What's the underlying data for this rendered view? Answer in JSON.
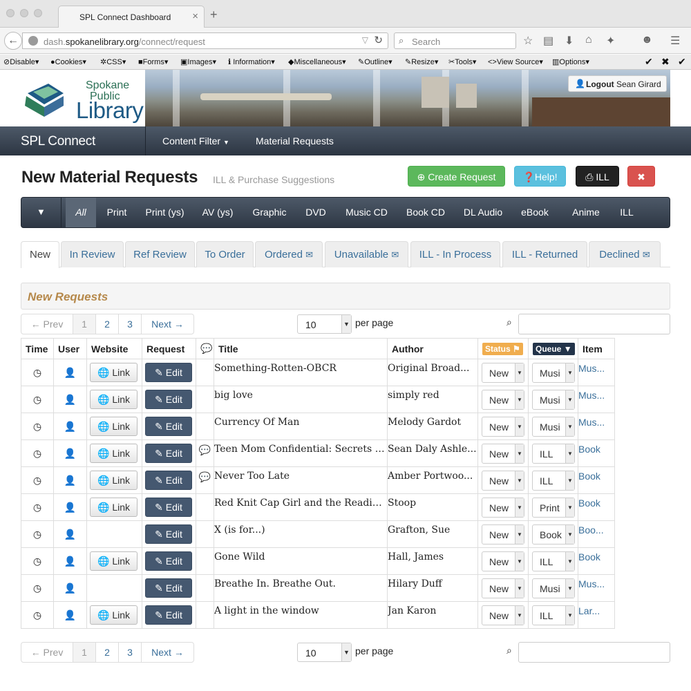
{
  "browser": {
    "tab_title": "SPL Connect Dashboard",
    "url_prefix": "dash.",
    "url_domain": "spokanelibrary.org",
    "url_path": "/connect/request",
    "search_placeholder": "Search"
  },
  "devtoolbar": {
    "items": [
      "Disable",
      "Cookies",
      "CSS",
      "Forms",
      "Images",
      "Information",
      "Miscellaneous",
      "Outline",
      "Resize",
      "Tools",
      "View Source",
      "Options"
    ]
  },
  "header": {
    "logo_line1": "Spokane",
    "logo_line2": "Public",
    "logo_line3": "Library",
    "logout_label": "Logout",
    "user_name": "Sean Girard"
  },
  "mainnav": {
    "brand": "SPL Connect",
    "content_filter": "Content Filter",
    "material_requests": "Material Requests"
  },
  "page": {
    "title": "New Material Requests",
    "subtitle": "ILL & Purchase Suggestions",
    "create_label": "Create Request",
    "help_label": "Help!",
    "ill_label": "ILL",
    "close_label": "✖"
  },
  "types": [
    "All",
    "Print",
    "Print (ys)",
    "AV (ys)",
    "Graphic",
    "DVD",
    "Music CD",
    "Book CD",
    "DL Audio",
    "eBook",
    "Anime",
    "ILL"
  ],
  "status_tabs": [
    "New",
    "In Review",
    "Ref Review",
    "To Order",
    "Ordered",
    "Unavailable",
    "ILL - In Process",
    "ILL - Returned",
    "Declined"
  ],
  "section_title": "New Requests",
  "pager": {
    "prev": "← Prev",
    "pages": [
      "1",
      "2",
      "3"
    ],
    "next": "Next →",
    "per_page_value": "10",
    "per_page_label": "per page"
  },
  "table": {
    "headers": {
      "time": "Time",
      "user": "User",
      "website": "Website",
      "request": "Request",
      "title": "Title",
      "author": "Author",
      "status": "Status",
      "queue": "Queue",
      "item": "Item"
    },
    "link_label": "Link",
    "edit_label": "Edit",
    "rows": [
      {
        "title": "Something-Rotten-OBCR",
        "author": "Original Broad...",
        "status": "New",
        "queue": "Musi",
        "item": "Mus...",
        "link": true,
        "comment": false
      },
      {
        "title": "big love",
        "author": "simply red",
        "status": "New",
        "queue": "Musi",
        "item": "Mus...",
        "link": true,
        "comment": false
      },
      {
        "title": "Currency Of Man",
        "author": "Melody Gardot",
        "status": "New",
        "queue": "Musi",
        "item": "Mus...",
        "link": true,
        "comment": false
      },
      {
        "title": "Teen Mom Confidential: Secrets &...",
        "author": "Sean Daly Ashle...",
        "status": "New",
        "queue": "ILL",
        "item": "Book",
        "link": true,
        "comment": true
      },
      {
        "title": "Never Too Late",
        "author": "Amber Portwoo...",
        "status": "New",
        "queue": "ILL",
        "item": "Book",
        "link": true,
        "comment": true
      },
      {
        "title": "Red Knit Cap Girl and the Readin...",
        "author": "Stoop",
        "status": "New",
        "queue": "Print",
        "item": "Book",
        "link": true,
        "comment": false
      },
      {
        "title": "X (is for...)",
        "author": "Grafton, Sue",
        "status": "New",
        "queue": "Book",
        "item": "Boo...",
        "link": false,
        "comment": false
      },
      {
        "title": "Gone Wild",
        "author": "Hall, James",
        "status": "New",
        "queue": "ILL",
        "item": "Book",
        "link": true,
        "comment": false
      },
      {
        "title": "Breathe In. Breathe Out.",
        "author": "Hilary Duff",
        "status": "New",
        "queue": "Musi",
        "item": "Mus...",
        "link": false,
        "comment": false
      },
      {
        "title": "A light in the window",
        "author": "Jan Karon",
        "status": "New",
        "queue": "ILL",
        "item": "Lar...",
        "link": true,
        "comment": false
      }
    ]
  }
}
